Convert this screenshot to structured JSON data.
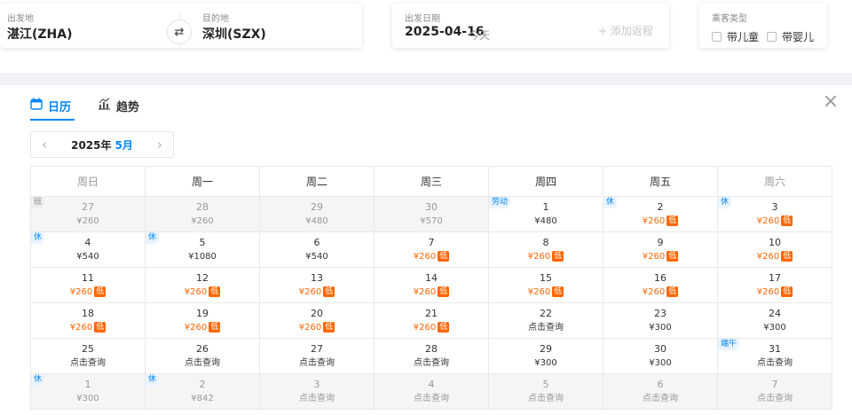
{
  "search": {
    "depart_label": "出发地",
    "depart_value": "湛江(ZHA)",
    "dest_label": "目的地",
    "dest_value": "深圳(SZX)",
    "date_label": "出发日期",
    "date_value": "2025-04-16",
    "date_note": "今天",
    "add_return": "+ 添加返程",
    "passenger_label": "乘客类型",
    "child": "带儿童",
    "infant": "带婴儿"
  },
  "tabs": [
    {
      "label": "日历",
      "icon": "calendar-icon",
      "active": true
    },
    {
      "label": "趋势",
      "icon": "chart-icon",
      "active": false
    }
  ],
  "month": {
    "year": "2025年",
    "month": "5月"
  },
  "weekdays": [
    "周日",
    "周一",
    "周二",
    "周三",
    "周四",
    "周五",
    "周六"
  ],
  "low_tag": "低",
  "weeks": [
    [
      {
        "day": "27",
        "price": "¥260",
        "out": true,
        "tag": "班",
        "tagType": "work"
      },
      {
        "day": "28",
        "price": "¥260",
        "out": true
      },
      {
        "day": "29",
        "price": "¥480",
        "out": true
      },
      {
        "day": "30",
        "price": "¥570",
        "out": true
      },
      {
        "day": "1",
        "price": "¥480",
        "tag": "劳动",
        "tagType": "hol"
      },
      {
        "day": "2",
        "price": "¥260",
        "low": true,
        "tag": "休",
        "tagType": "hol"
      },
      {
        "day": "3",
        "price": "¥260",
        "low": true,
        "tag": "休",
        "tagType": "hol"
      }
    ],
    [
      {
        "day": "4",
        "price": "¥540",
        "tag": "休",
        "tagType": "hol"
      },
      {
        "day": "5",
        "price": "¥1080",
        "tag": "休",
        "tagType": "hol"
      },
      {
        "day": "6",
        "price": "¥540"
      },
      {
        "day": "7",
        "price": "¥260",
        "low": true
      },
      {
        "day": "8",
        "price": "¥260",
        "low": true
      },
      {
        "day": "9",
        "price": "¥260",
        "low": true
      },
      {
        "day": "10",
        "price": "¥260",
        "low": true
      }
    ],
    [
      {
        "day": "11",
        "price": "¥260",
        "low": true
      },
      {
        "day": "12",
        "price": "¥260",
        "low": true
      },
      {
        "day": "13",
        "price": "¥260",
        "low": true
      },
      {
        "day": "14",
        "price": "¥260",
        "low": true
      },
      {
        "day": "15",
        "price": "¥260",
        "low": true
      },
      {
        "day": "16",
        "price": "¥260",
        "low": true
      },
      {
        "day": "17",
        "price": "¥260",
        "low": true
      }
    ],
    [
      {
        "day": "18",
        "price": "¥260",
        "low": true
      },
      {
        "day": "19",
        "price": "¥260",
        "low": true
      },
      {
        "day": "20",
        "price": "¥260",
        "low": true
      },
      {
        "day": "21",
        "price": "¥260",
        "low": true
      },
      {
        "day": "22",
        "price": "点击查询"
      },
      {
        "day": "23",
        "price": "¥300"
      },
      {
        "day": "24",
        "price": "¥300"
      }
    ],
    [
      {
        "day": "25",
        "price": "点击查询"
      },
      {
        "day": "26",
        "price": "点击查询"
      },
      {
        "day": "27",
        "price": "点击查询"
      },
      {
        "day": "28",
        "price": "点击查询"
      },
      {
        "day": "29",
        "price": "¥300"
      },
      {
        "day": "30",
        "price": "¥300"
      },
      {
        "day": "31",
        "price": "点击查询",
        "tag": "端午",
        "tagType": "hol"
      }
    ],
    [
      {
        "day": "1",
        "price": "¥300",
        "out": true,
        "tag": "休",
        "tagType": "hol"
      },
      {
        "day": "2",
        "price": "¥842",
        "out": true,
        "tag": "休",
        "tagType": "hol"
      },
      {
        "day": "3",
        "price": "点击查询",
        "out": true
      },
      {
        "day": "4",
        "price": "点击查询",
        "out": true
      },
      {
        "day": "5",
        "price": "点击查询",
        "out": true
      },
      {
        "day": "6",
        "price": "点击查询",
        "out": true
      },
      {
        "day": "7",
        "price": "点击查询",
        "out": true
      }
    ]
  ],
  "colors": {
    "accent": "#0086f6",
    "low": "#ff6600"
  }
}
